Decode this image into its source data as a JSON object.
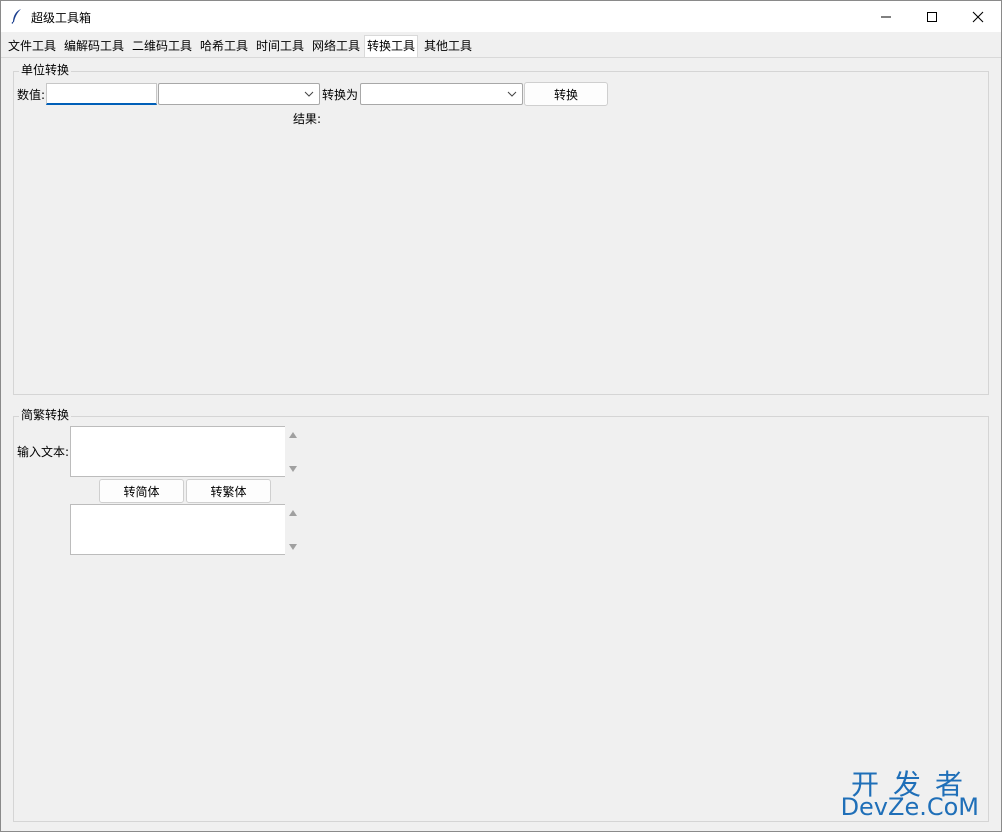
{
  "window": {
    "title": "超级工具箱"
  },
  "tabs": [
    {
      "label": "文件工具"
    },
    {
      "label": "编解码工具"
    },
    {
      "label": "二维码工具"
    },
    {
      "label": "哈希工具"
    },
    {
      "label": "时间工具"
    },
    {
      "label": "网络工具"
    },
    {
      "label": "转换工具"
    },
    {
      "label": "其他工具"
    }
  ],
  "active_tab": "转换工具",
  "unit_conversion": {
    "group_title": "单位转换",
    "value_label": "数值:",
    "value_input": "",
    "from_unit_selected": "",
    "convert_to_label": "转换为",
    "to_unit_selected": "",
    "convert_button": "转换",
    "result_label": "结果:"
  },
  "simp_trad": {
    "group_title": "简繁转换",
    "input_label": "输入文本:",
    "input_text": "",
    "to_simplified_button": "转简体",
    "to_traditional_button": "转繁体",
    "output_text": ""
  },
  "watermark": {
    "line1": "开发者",
    "line2": "DevZe.CoM"
  },
  "colors": {
    "focus_accent": "#005fb8",
    "watermark": "#1f6fb8"
  }
}
